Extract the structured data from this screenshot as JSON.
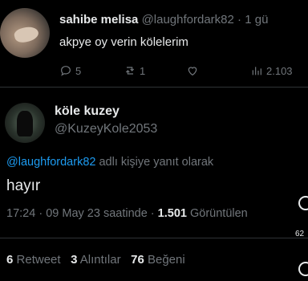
{
  "tweet": {
    "display_name": "sahibe melisa",
    "handle": "@laughfordark82",
    "separator": "·",
    "age": "1 gü",
    "text": "akpye oy verin kölelerim",
    "actions": {
      "replies": "5",
      "retweets": "1",
      "likes": "",
      "views": "2.103"
    }
  },
  "reply": {
    "display_name": "köle kuzey",
    "handle": "@KuzeyKole2053",
    "reply_to_handle": "@laughfordark82",
    "reply_to_suffix": " adlı kişiye yanıt olarak",
    "text": "hayır",
    "time": "17:24",
    "date": "09 May 23 saatinde",
    "views_count": "1.501",
    "views_label": "Görüntülen",
    "stats": {
      "retweets_count": "6",
      "retweets_label": "Retweet",
      "quotes_count": "3",
      "quotes_label": "Alıntılar",
      "likes_count": "76",
      "likes_label": "Beğeni"
    }
  },
  "edge": {
    "count": "62"
  },
  "colors": {
    "background": "#000000",
    "text": "#e7e9ea",
    "muted": "#71767b",
    "link": "#1d9bf0",
    "divider": "#2f3336"
  }
}
